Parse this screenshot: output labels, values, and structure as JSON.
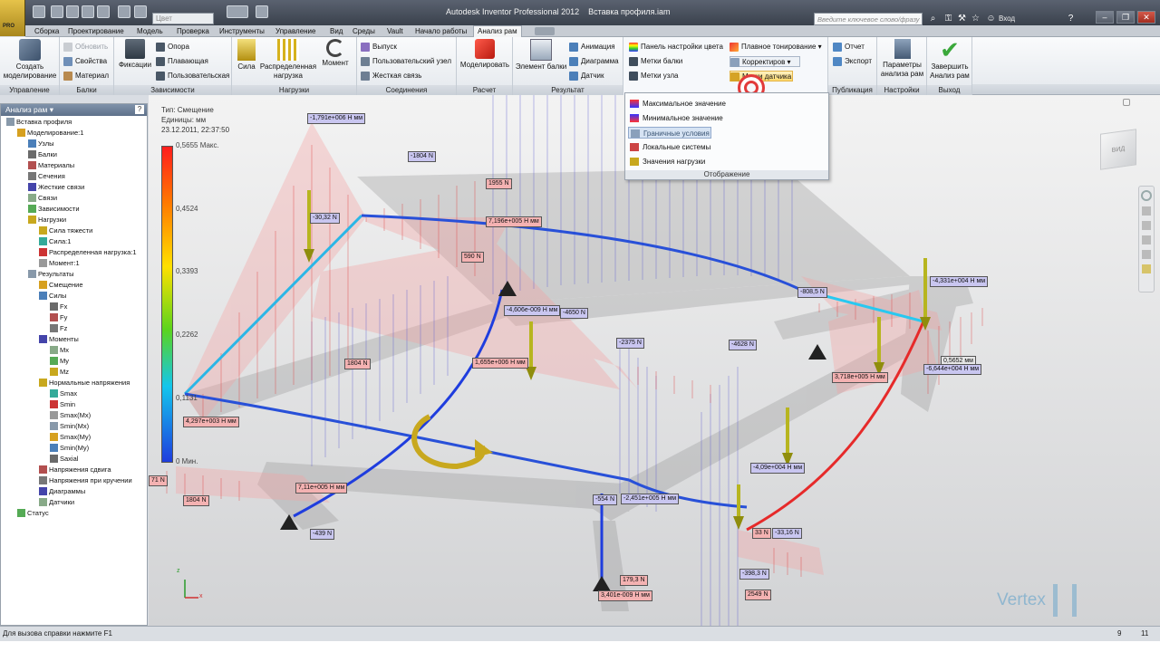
{
  "title": {
    "app": "Autodesk Inventor Professional 2012",
    "doc": "Вставка профиля.iam"
  },
  "quick_access": {
    "color_box": "Цвет"
  },
  "search": {
    "placeholder": "Введите ключевое слово/фразу",
    "login": "Вход"
  },
  "menu": [
    "Сборка",
    "Проектирование",
    "Модель",
    "Проверка",
    "Инструменты",
    "Управление",
    "Вид",
    "Среды",
    "Vault",
    "Начало работы",
    "Анализ рам"
  ],
  "ribbon": {
    "groups": {
      "upravlenie": "Управление",
      "balki": "Балки",
      "zavisimosti": "Зависимости",
      "nagruzki": "Нагрузки",
      "soedineniya": "Соединения",
      "raschet": "Расчет",
      "rezultat": "Результат",
      "publikatsiya": "Публикация",
      "nastroyki": "Настройки",
      "vykhod": "Выход"
    },
    "create_sim": "Создать\nмоделирование",
    "refresh": "Обновить",
    "props": "Свойства",
    "material": "Материал",
    "fixed": "Фиксации",
    "support": "Опора",
    "floating": "Плавающая",
    "custom": "Пользовательская",
    "force": "Сила",
    "dist_load": "Распределенная\nнагрузка",
    "moment": "Момент",
    "release": "Выпуск",
    "custom_node": "Пользовательский узел",
    "rigid_link": "Жесткая связь",
    "simulate": "Моделировать",
    "beam_element": "Элемент балки",
    "animation": "Анимация",
    "diagram": "Диаграмма",
    "probe": "Датчик",
    "color_bar": "Панель настройки цвета",
    "beam_labels": "Метки балки",
    "node_labels": "Метки узла",
    "smooth_shading": "Плавное тонирование",
    "adjusters": "Корректиров",
    "probe_labels": "Метки датчика",
    "report": "Отчет",
    "export": "Экспорт",
    "params": "Параметры\nанализа рам",
    "finish": "Завершить\nАнализ рам"
  },
  "display_menu": {
    "items": [
      "Максимальное значение",
      "Минимальное значение",
      "Граничные условия",
      "Локальные системы",
      "Значения нагрузки"
    ],
    "highlighted_index": 2,
    "footer": "Отображение"
  },
  "browser": {
    "title": "Анализ рам",
    "items": [
      {
        "label": "Вставка профиля",
        "lvl": 0
      },
      {
        "label": "Моделирование:1",
        "lvl": 1
      },
      {
        "label": "Узлы",
        "lvl": 2
      },
      {
        "label": "Балки",
        "lvl": 2
      },
      {
        "label": "Материалы",
        "lvl": 2
      },
      {
        "label": "Сечения",
        "lvl": 2
      },
      {
        "label": "Жесткие связи",
        "lvl": 2
      },
      {
        "label": "Связи",
        "lvl": 2
      },
      {
        "label": "Зависимости",
        "lvl": 2
      },
      {
        "label": "Нагрузки",
        "lvl": 2
      },
      {
        "label": "Сила тяжести",
        "lvl": 3
      },
      {
        "label": "Сила:1",
        "lvl": 3
      },
      {
        "label": "Распределенная нагрузка:1",
        "lvl": 3
      },
      {
        "label": "Момент:1",
        "lvl": 3
      },
      {
        "label": "Результаты",
        "lvl": 2
      },
      {
        "label": "Смещение",
        "lvl": 3
      },
      {
        "label": "Силы",
        "lvl": 3
      },
      {
        "label": "Fx",
        "lvl": 4
      },
      {
        "label": "Fy",
        "lvl": 4
      },
      {
        "label": "Fz",
        "lvl": 4
      },
      {
        "label": "Моменты",
        "lvl": 3
      },
      {
        "label": "Mx",
        "lvl": 4
      },
      {
        "label": "My",
        "lvl": 4
      },
      {
        "label": "Mz",
        "lvl": 4
      },
      {
        "label": "Нормальные напряжения",
        "lvl": 3
      },
      {
        "label": "Smax",
        "lvl": 4
      },
      {
        "label": "Smin",
        "lvl": 4
      },
      {
        "label": "Smax(Mx)",
        "lvl": 4
      },
      {
        "label": "Smin(Mx)",
        "lvl": 4
      },
      {
        "label": "Smax(My)",
        "lvl": 4
      },
      {
        "label": "Smin(My)",
        "lvl": 4
      },
      {
        "label": "Saxial",
        "lvl": 4
      },
      {
        "label": "Напряжения сдвига",
        "lvl": 3
      },
      {
        "label": "Напряжения при кручении",
        "lvl": 3
      },
      {
        "label": "Диаграммы",
        "lvl": 3
      },
      {
        "label": "Датчики",
        "lvl": 3
      },
      {
        "label": "Статус",
        "lvl": 1
      }
    ]
  },
  "legend": {
    "type": "Тип: Смещение",
    "units": "Единицы: мм",
    "date": "23.12.2011, 22:37:50",
    "ticks": [
      "0,5655 Макс.",
      "0,4524",
      "0,3393",
      "0,2262",
      "0,1131",
      "0 Мин."
    ]
  },
  "labels": [
    {
      "t": "-1,791e+006 Н мм",
      "c": "lp"
    },
    {
      "t": "-1804 N",
      "c": "lp"
    },
    {
      "t": "1955 N",
      "c": "lr"
    },
    {
      "t": "-30,32 N",
      "c": "lp"
    },
    {
      "t": "7,196e+005 Н мм",
      "c": "lr"
    },
    {
      "t": "590 N",
      "c": "lr"
    },
    {
      "t": "-4,606e-009 Н мм",
      "c": "lp"
    },
    {
      "t": "-4650 N",
      "c": "lp"
    },
    {
      "t": "-808,5 N",
      "c": "lp"
    },
    {
      "t": "-4,331e+004 Н мм",
      "c": "lp"
    },
    {
      "t": "-2375 N",
      "c": "lp"
    },
    {
      "t": "-4628 N",
      "c": "lp"
    },
    {
      "t": "1804 N",
      "c": "lr"
    },
    {
      "t": "1,655e+006 Н мм",
      "c": "lr"
    },
    {
      "t": "3,718e+005 Н мм",
      "c": "lr"
    },
    {
      "t": "0,5652 мм",
      "c": "lg"
    },
    {
      "t": "-6,644e+004 Н мм",
      "c": "lp"
    },
    {
      "t": "4,297e+003 Н мм",
      "c": "lr"
    },
    {
      "t": "71 N",
      "c": "lr"
    },
    {
      "t": "-4,09e+004 Н мм",
      "c": "lp"
    },
    {
      "t": "1804 N",
      "c": "lr"
    },
    {
      "t": "7,11e+005 Н мм",
      "c": "lr"
    },
    {
      "t": "-554 N",
      "c": "lp"
    },
    {
      "t": "-2,451e+005 Н мм",
      "c": "lp"
    },
    {
      "t": "33 N",
      "c": "lr"
    },
    {
      "t": "-33,16 N",
      "c": "lp"
    },
    {
      "t": "-439 N",
      "c": "lp"
    },
    {
      "t": "-398,3 N",
      "c": "lp"
    },
    {
      "t": "179,3 N",
      "c": "lr"
    },
    {
      "t": "3,401e-009 Н мм",
      "c": "lr"
    },
    {
      "t": "2549 N",
      "c": "lr"
    }
  ],
  "axes": {
    "x": "x",
    "z": "z"
  },
  "viewcube": "ВИД",
  "watermark": "Vertex",
  "status": {
    "hint": "Для вызова справки нажмите F1",
    "a": "9",
    "b": "11"
  }
}
